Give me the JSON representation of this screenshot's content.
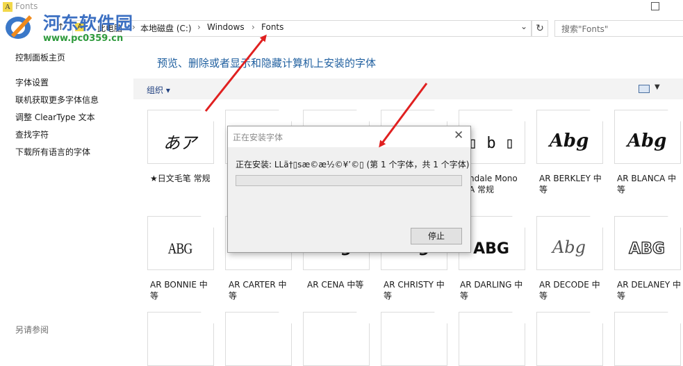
{
  "window": {
    "title": "Fonts",
    "app_icon_letter": "A"
  },
  "watermark": {
    "title": "河东软件园",
    "url": "www.pc0359.cn"
  },
  "address_bar": {
    "breadcrumbs": [
      "此电脑",
      "本地磁盘 (C:)",
      "Windows",
      "Fonts"
    ],
    "search_placeholder": "搜索\"Fonts\""
  },
  "sidebar": {
    "home": "控制面板主页",
    "links": [
      "字体设置",
      "联机获取更多字体信息",
      "调整 ClearType 文本",
      "查找字符",
      "下载所有语言的字体"
    ],
    "see_also": "另请参阅"
  },
  "main": {
    "heading": "预览、删除或者显示和隐藏计算机上安装的字体",
    "toolbar": {
      "organize": "组织 ▾"
    }
  },
  "fonts_row1": [
    {
      "glyph": "あア",
      "label": "★日文毛笔 常规"
    },
    {
      "glyph": "",
      "label": ""
    },
    {
      "glyph": "",
      "label": ""
    },
    {
      "glyph": "",
      "label": ""
    },
    {
      "glyph": "▯ b ▯",
      "label": "ndale Mono\nA 常规"
    },
    {
      "glyph": "Abg",
      "label": "AR BERKLEY 中\n等"
    },
    {
      "glyph": "Abg",
      "label": "AR BLANCA 中\n等"
    }
  ],
  "fonts_row2": [
    {
      "glyph": "ABG",
      "label": "AR BONNIE 中\n等"
    },
    {
      "glyph": "",
      "label": "AR CARTER 中\n等"
    },
    {
      "glyph": "Abg",
      "label": "AR CENA 中等"
    },
    {
      "glyph": "Abg",
      "label": "AR CHRISTY 中\n等"
    },
    {
      "glyph": "ABG",
      "label": "AR DARLING 中\n等"
    },
    {
      "glyph": "Abg",
      "label": "AR DECODE 中\n等"
    },
    {
      "glyph": "ABG",
      "label": "AR DELANEY 中\n等"
    }
  ],
  "dialog": {
    "title": "正在安装字体",
    "status": "正在安装: LLä†▯sæ©æ½©¥’©▯ (第 1 个字体，共 1 个字体)",
    "progress": 0.0,
    "stop_label": "停止",
    "close_glyph": "✕"
  },
  "colors": {
    "heading": "#1f5f9f",
    "progress_fill": "#06b025",
    "arrow": "#e02020"
  }
}
